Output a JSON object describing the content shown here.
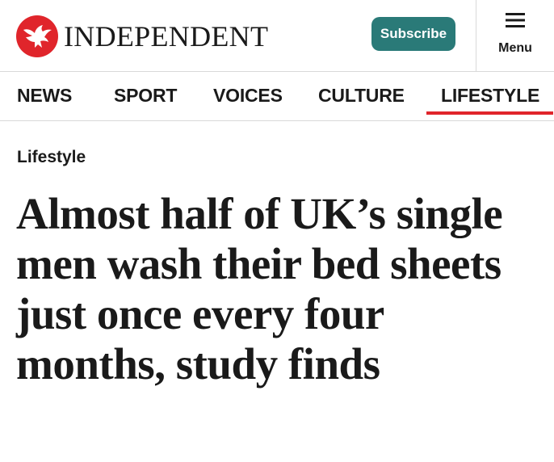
{
  "header": {
    "logo_text": "INDEPENDENT",
    "logo_icon": "eagle-logo-icon",
    "subscribe_label": "Subscribe",
    "menu_label": "Menu",
    "menu_icon": "hamburger-icon"
  },
  "nav": {
    "items": [
      {
        "label": "NEWS"
      },
      {
        "label": "SPORT"
      },
      {
        "label": "VOICES"
      },
      {
        "label": "CULTURE"
      },
      {
        "label": "LIFESTYLE",
        "active": true
      }
    ]
  },
  "article": {
    "section": "Lifestyle",
    "headline": "Almost half of UK’s single men wash their bed sheets just once every four months, study finds"
  },
  "colors": {
    "brand_red": "#e0252b",
    "subscribe_teal": "#2a7a78",
    "text": "#1a1a1a",
    "divider": "#d9d9d9"
  }
}
